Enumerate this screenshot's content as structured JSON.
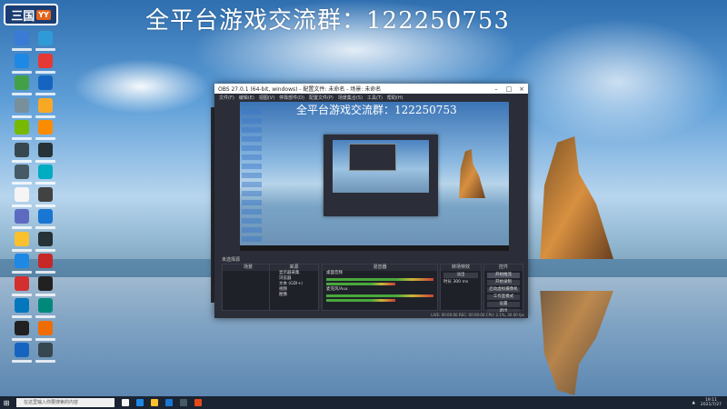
{
  "banner": "全平台游戏交流群：122250753",
  "logo": {
    "text": "三国",
    "tag": "YY"
  },
  "desktop_icons": [
    {
      "color": "#3a7bd5"
    },
    {
      "color": "#2e9bd6"
    },
    {
      "color": "#1e88e5"
    },
    {
      "color": "#e53935"
    },
    {
      "color": "#43a047"
    },
    {
      "color": "#1565c0"
    },
    {
      "color": "#78909c"
    },
    {
      "color": "#f9a825"
    },
    {
      "color": "#76b900"
    },
    {
      "color": "#fb8c00"
    },
    {
      "color": "#37474f"
    },
    {
      "color": "#263238"
    },
    {
      "color": "#455a64"
    },
    {
      "color": "#00acc1"
    },
    {
      "color": "#f5f5f5"
    },
    {
      "color": "#424242"
    },
    {
      "color": "#5c6bc0"
    },
    {
      "color": "#1976d2"
    },
    {
      "color": "#fbc02d"
    },
    {
      "color": "#263238"
    },
    {
      "color": "#1e88e5"
    },
    {
      "color": "#c62828"
    },
    {
      "color": "#d32f2f"
    },
    {
      "color": "#212121"
    },
    {
      "color": "#0277bd"
    },
    {
      "color": "#00897b"
    },
    {
      "color": "#212121"
    },
    {
      "color": "#ef6c00"
    },
    {
      "color": "#1565c0"
    },
    {
      "color": "#37474f"
    }
  ],
  "obs": {
    "title": "OBS 27.0.1 (64-bit, windows) - 配置文件: 未命名 - 场景: 未命名",
    "menu": [
      "文件(F)",
      "编辑(E)",
      "视图(V)",
      "停靠部件(D)",
      "配置文件(P)",
      "场景集合(S)",
      "工具(T)",
      "帮助(H)"
    ],
    "preview_banner": "全平台游戏交流群：122250753",
    "dock_title": "未选择源",
    "scenes_header": "场景",
    "sources_header": "来源",
    "sources": [
      "显示器采集",
      "浏览器",
      "文本 (GDI+)",
      "视频",
      "图像"
    ],
    "mixer_header": "混音器",
    "mixer_tracks": [
      "桌面音频",
      "麦克风/Aux"
    ],
    "transitions_header": "转场特效",
    "transition_type": "淡出",
    "transition_duration_label": "时长",
    "transition_duration": "300 ms",
    "controls_header": "控件",
    "controls": [
      "开始推流",
      "开始录制",
      "启动虚拟摄像机",
      "工作室模式",
      "设置",
      "退出"
    ],
    "status": "LIVE: 00:00:00  REC: 00:00:00  CPU: 2.1%, 30.00 fps"
  },
  "taskbar": {
    "search_placeholder": "在这里输入你要搜索的内容",
    "time": "19:11",
    "date": "2021/7/27",
    "apps": [
      {
        "color": "#f5f5f5"
      },
      {
        "color": "#1e88e5"
      },
      {
        "color": "#fbc02d"
      },
      {
        "color": "#1976d2"
      },
      {
        "color": "#455a64"
      },
      {
        "color": "#e64a19"
      }
    ]
  }
}
